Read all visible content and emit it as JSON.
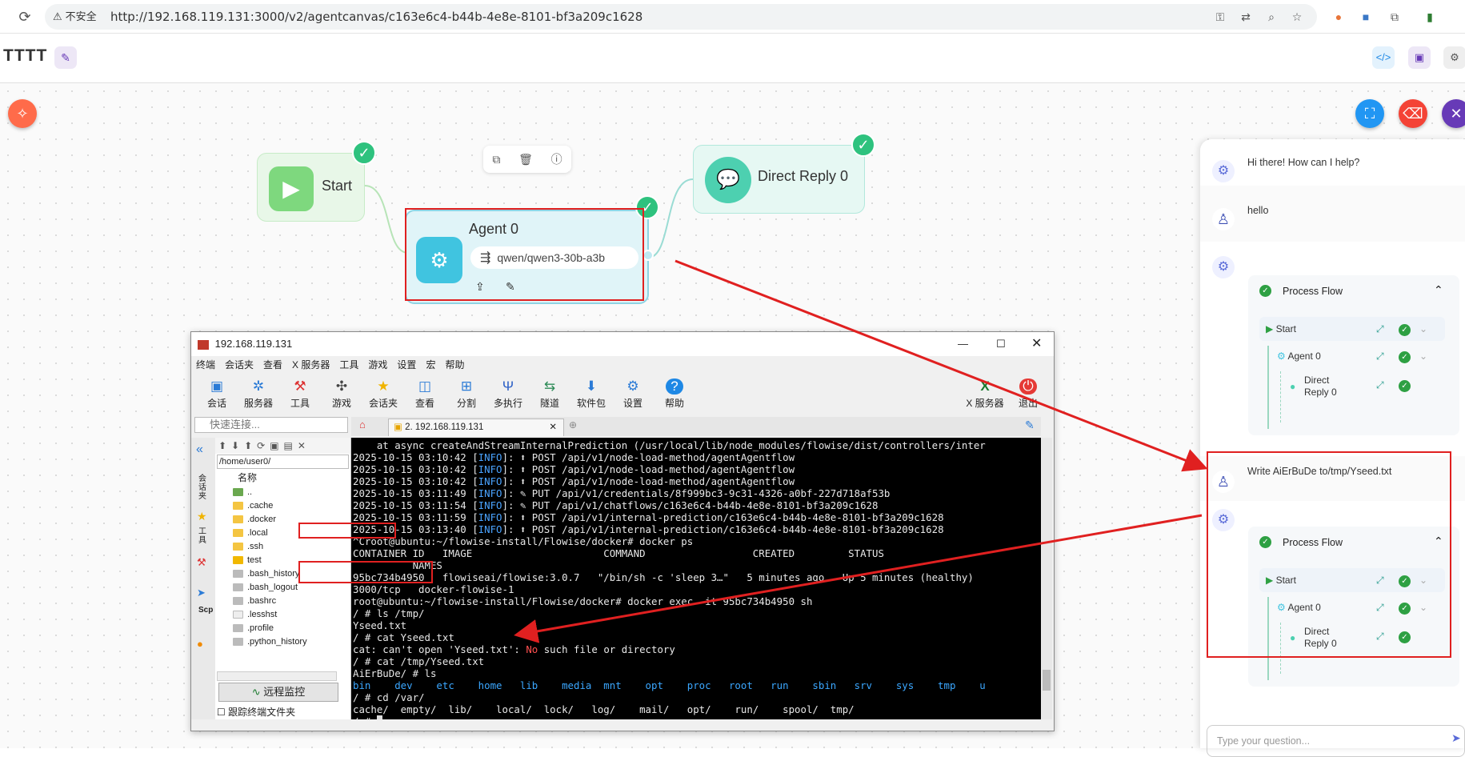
{
  "browser": {
    "security_label": "不安全",
    "url": "http://192.168.119.131:3000/v2/agentcanvas/c163e6c4-b44b-4e8e-8101-bf3a209c1628"
  },
  "app": {
    "flow_title": "TTTT"
  },
  "canvas": {
    "nodes": {
      "start_label": "Start",
      "agent_label": "Agent 0",
      "agent_model": "qwen/qwen3-30b-a3b",
      "reply_label": "Direct Reply 0"
    }
  },
  "xshell": {
    "window_title": "192.168.119.131",
    "menu": [
      "终端",
      "会话夹",
      "查看",
      "X 服务器",
      "工具",
      "游戏",
      "设置",
      "宏",
      "帮助"
    ],
    "toolbar": [
      "会话",
      "服务器",
      "工具",
      "游戏",
      "会话夹",
      "查看",
      "分割",
      "多执行",
      "隧道",
      "软件包",
      "设置",
      "帮助"
    ],
    "toolbar_right": [
      "X 服务器",
      "退出"
    ],
    "quick_connect_placeholder": "快速连接...",
    "tab_label": "2. 192.168.119.131",
    "file_path": "/home/user0/",
    "file_header": "名称",
    "files": [
      "..",
      ".cache",
      ".docker",
      ".local",
      ".ssh",
      "test",
      ".bash_history",
      ".bash_logout",
      ".bashrc",
      ".lesshst",
      ".profile",
      ".python_history"
    ],
    "side_tabs": [
      "会话夹",
      "工具",
      "Scp"
    ],
    "remote_monitor": "远程监控",
    "follow_dir_label": "跟踪终端文件夹",
    "terminal_lines": [
      "    at async createAndStreamInternalPrediction (/usr/local/lib/node_modules/flowise/dist/controllers/inter",
      "2025-10-15 03:10:42 [INFO]: ⬆ POST /api/v1/node-load-method/agentAgentflow",
      "2025-10-15 03:10:42 [INFO]: ⬆ POST /api/v1/node-load-method/agentAgentflow",
      "2025-10-15 03:10:42 [INFO]: ⬆ POST /api/v1/node-load-method/agentAgentflow",
      "2025-10-15 03:11:49 [INFO]: ✎ PUT /api/v1/credentials/8f999bc3-9c31-4326-a0bf-227d718af53b",
      "2025-10-15 03:11:54 [INFO]: ✎ PUT /api/v1/chatflows/c163e6c4-b44b-4e8e-8101-bf3a209c1628",
      "2025-10-15 03:11:59 [INFO]: ⬆ POST /api/v1/internal-prediction/c163e6c4-b44b-4e8e-8101-bf3a209c1628",
      "2025-10-15 03:13:40 [INFO]: ⬆ POST /api/v1/internal-prediction/c163e6c4-b44b-4e8e-8101-bf3a209c1628",
      "^Croot@ubuntu:~/flowise-install/Flowise/docker# docker ps",
      "CONTAINER ID   IMAGE                      COMMAND                  CREATED         STATUS",
      "          NAMES",
      "95bc734b4950   flowiseai/flowise:3.0.7   \"/bin/sh -c 'sleep 3…\"   5 minutes ago   Up 5 minutes (healthy)",
      "3000/tcp   docker-flowise-1",
      "root@ubuntu:~/flowise-install/Flowise/docker# docker exec -it 95bc734b4950 sh",
      "/ # ls /tmp/",
      "Yseed.txt",
      "/ # cat Yseed.txt",
      "cat: can't open 'Yseed.txt': No such file or directory",
      "/ # cat /tmp/Yseed.txt",
      "AiErBuDe/ # ls",
      "bin    dev    etc    home   lib    media  mnt    opt    proc   root   run    sbin   srv    sys    tmp    u",
      "/ # cd /var/",
      "cache/  empty/  lib/    local/  lock/   log/    mail/   opt/    run/    spool/  tmp/",
      "/ # "
    ]
  },
  "chat": {
    "greeting": "Hi there! How can I help?",
    "user_msg_1": "hello",
    "process_flow_label": "Process Flow",
    "flow_steps": [
      "Start",
      "Agent 0",
      "Direct Reply 0"
    ],
    "user_msg_2": "Write AiErBuDe to/tmp/Yseed.txt",
    "input_placeholder": "Type your question..."
  },
  "colors": {
    "accent_red": "#e02020",
    "success_green": "#2ec27e",
    "agent_node_bg": "#e0f4f8",
    "start_node_bg": "#e8f7e8",
    "reply_node_bg": "#e6f8f3"
  }
}
